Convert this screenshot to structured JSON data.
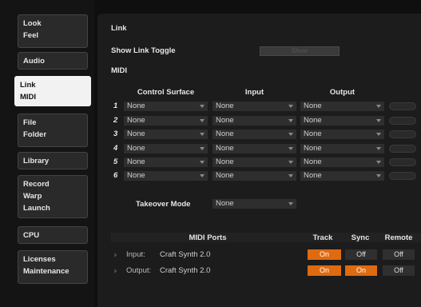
{
  "sidebar": {
    "tabs": [
      {
        "line1": "Look",
        "line2": "Feel"
      },
      {
        "line1": "Audio",
        "line2": ""
      },
      {
        "line1": "Link",
        "line2": "MIDI"
      },
      {
        "line1": "File",
        "line2": "Folder"
      },
      {
        "line1": "Library",
        "line2": ""
      },
      {
        "line1": "Record",
        "line2": "Warp",
        "line3": "Launch"
      },
      {
        "line1": "CPU",
        "line2": ""
      },
      {
        "line1": "Licenses",
        "line2": "Maintenance"
      }
    ]
  },
  "main": {
    "link_section": "Link",
    "show_link_toggle_label": "Show Link Toggle",
    "show_link_toggle_value": "Show",
    "midi_section": "MIDI",
    "headers": {
      "control_surface": "Control Surface",
      "input": "Input",
      "output": "Output"
    },
    "rows": [
      {
        "num": "1",
        "cs": "None",
        "in": "None",
        "out": "None"
      },
      {
        "num": "2",
        "cs": "None",
        "in": "None",
        "out": "None"
      },
      {
        "num": "3",
        "cs": "None",
        "in": "None",
        "out": "None"
      },
      {
        "num": "4",
        "cs": "None",
        "in": "None",
        "out": "None"
      },
      {
        "num": "5",
        "cs": "None",
        "in": "None",
        "out": "None"
      },
      {
        "num": "6",
        "cs": "None",
        "in": "None",
        "out": "None"
      }
    ],
    "takeover_label": "Takeover Mode",
    "takeover_value": "None",
    "ports": {
      "title": "MIDI Ports",
      "track": "Track",
      "sync": "Sync",
      "remote": "Remote",
      "rows": [
        {
          "dir": "Input:",
          "name": "Craft Synth 2.0",
          "track": "On",
          "sync": "Off",
          "remote": "Off"
        },
        {
          "dir": "Output:",
          "name": "Craft Synth 2.0",
          "track": "On",
          "sync": "On",
          "remote": "Off"
        }
      ]
    }
  },
  "colors": {
    "accent": "#e06a10",
    "active_tab": "#f2f2f2"
  }
}
